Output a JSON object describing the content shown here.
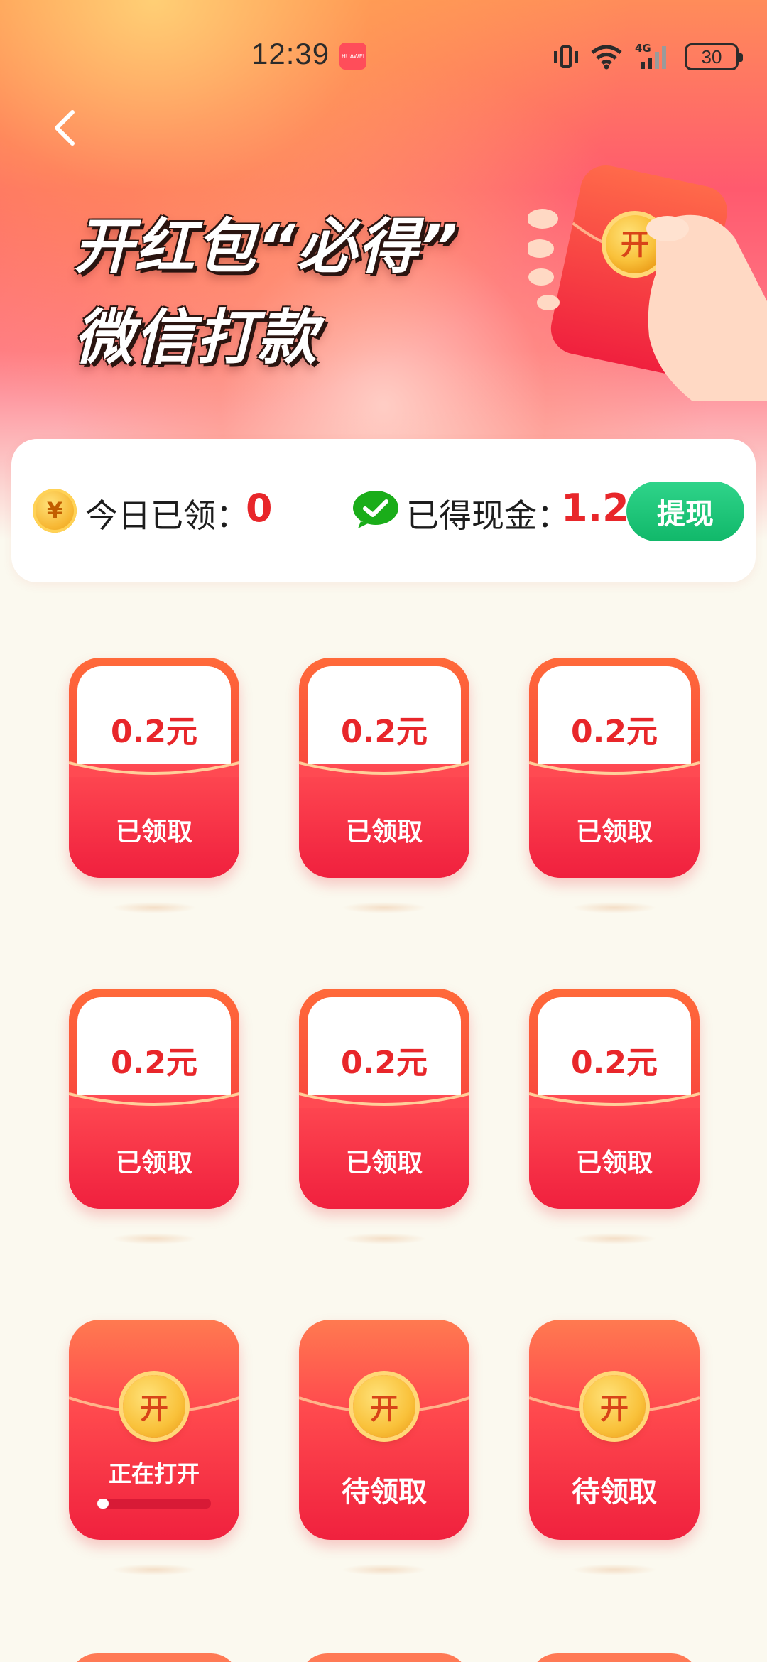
{
  "status_bar": {
    "time": "12:39",
    "app_badge": "HUAWEI",
    "network": "4G",
    "battery": "30"
  },
  "hero": {
    "title_line1": "开红包“必得”",
    "title_line2": "微信打款",
    "hand_coin_label": "开"
  },
  "stats": {
    "coin_symbol": "¥",
    "today_label": "今日已领：",
    "today_value": "0",
    "cash_label": "已得现金：",
    "cash_value": "1.2",
    "withdraw_label": "提现"
  },
  "packets": [
    {
      "amount": "0.2元",
      "status": "已领取"
    },
    {
      "amount": "0.2元",
      "status": "已领取"
    },
    {
      "amount": "0.2元",
      "status": "已领取"
    },
    {
      "amount": "0.2元",
      "status": "已领取"
    },
    {
      "amount": "0.2元",
      "status": "已领取"
    },
    {
      "amount": "0.2元",
      "status": "已领取"
    },
    {
      "coin": "开",
      "status": "正在打开",
      "progress": 0.1
    },
    {
      "coin": "开",
      "status": "待领取"
    },
    {
      "coin": "开",
      "status": "待领取"
    }
  ],
  "colors": {
    "accent_red": "#e8262a",
    "withdraw_green": "#11b86a"
  }
}
